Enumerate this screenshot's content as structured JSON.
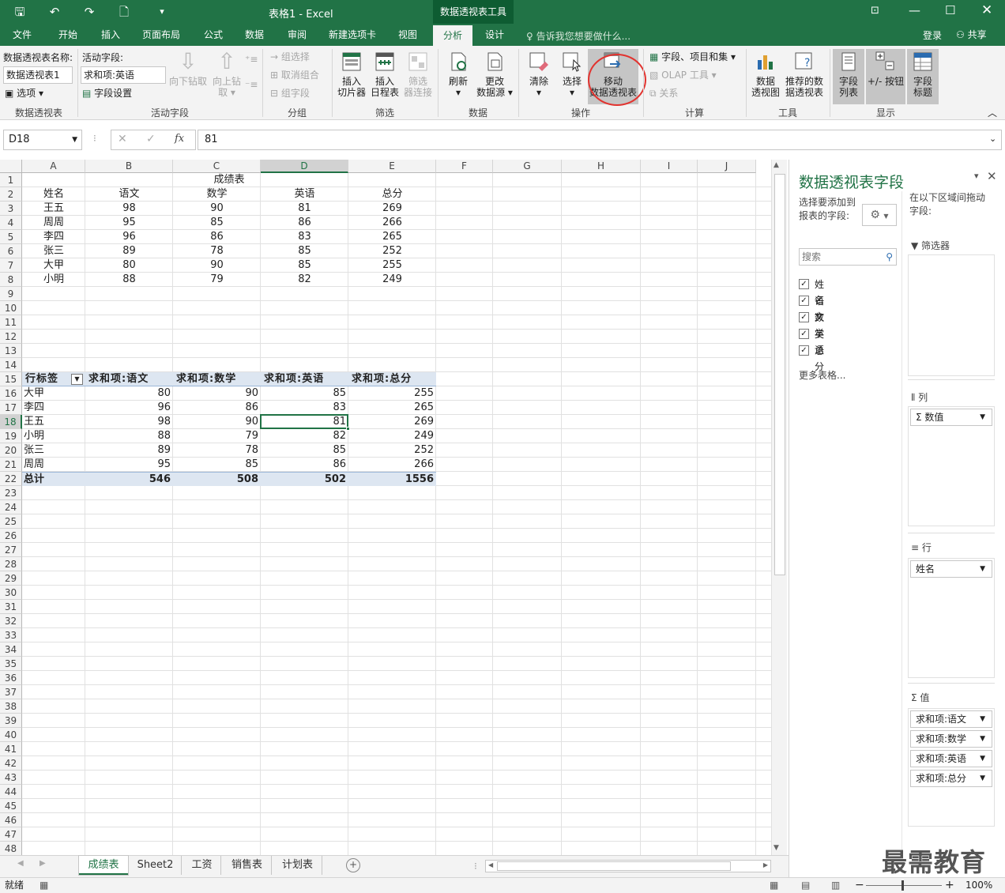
{
  "window": {
    "title": "表格1 - Excel",
    "context_tool": "数据透视表工具"
  },
  "tabs": [
    "文件",
    "开始",
    "插入",
    "页面布局",
    "公式",
    "数据",
    "审阅",
    "新建选项卡",
    "视图",
    "分析",
    "设计"
  ],
  "tellme": "告诉我您想要做什么...",
  "signin": "登录",
  "share": "共享",
  "ribbon": {
    "pt_name_label": "数据透视表名称:",
    "pt_name_value": "数据透视表1",
    "options": "选项",
    "grp_pivot": "数据透视表",
    "active_field_label": "活动字段:",
    "active_field_value": "求和项:英语",
    "field_settings": "字段设置",
    "drill_down": "向下钻取",
    "drill_up": "向上钻",
    "drill_up2": "取",
    "grp_active": "活动字段",
    "group_selection": "组选择",
    "ungroup": "取消组合",
    "group_field": "组字段",
    "grp_group": "分组",
    "insert_slicer": "插入",
    "insert_slicer2": "切片器",
    "insert_timeline": "插入",
    "insert_timeline2": "日程表",
    "filter_conn": "筛选",
    "filter_conn2": "器连接",
    "grp_filter": "筛选",
    "refresh": "刷新",
    "change_source": "更改",
    "change_source2": "数据源",
    "grp_data": "数据",
    "clear": "清除",
    "select": "选择",
    "move": "移动",
    "move2": "数据透视表",
    "grp_actions": "操作",
    "fields_items": "字段、项目和集",
    "olap": "OLAP 工具",
    "relations": "关系",
    "grp_calc": "计算",
    "pivotchart": "数据",
    "pivotchart2": "透视图",
    "recommended": "推荐的数",
    "recommended2": "据透视表",
    "grp_tools": "工具",
    "field_list": "字段",
    "field_list2": "列表",
    "buttons": "+/- 按钮",
    "headers": "字段",
    "headers2": "标题",
    "grp_show": "显示"
  },
  "formula": {
    "namebox": "D18",
    "value": "81"
  },
  "columns": [
    "A",
    "B",
    "C",
    "D",
    "E",
    "F",
    "G",
    "H",
    "I",
    "J"
  ],
  "source_table": {
    "title": "成绩表",
    "headers": [
      "姓名",
      "语文",
      "数学",
      "英语",
      "总分"
    ],
    "rows": [
      [
        "王五",
        "98",
        "90",
        "81",
        "269"
      ],
      [
        "周周",
        "95",
        "85",
        "86",
        "266"
      ],
      [
        "李四",
        "96",
        "86",
        "83",
        "265"
      ],
      [
        "张三",
        "89",
        "78",
        "85",
        "252"
      ],
      [
        "大甲",
        "80",
        "90",
        "85",
        "255"
      ],
      [
        "小明",
        "88",
        "79",
        "82",
        "249"
      ]
    ]
  },
  "pivot": {
    "headers": [
      "行标签",
      "求和项:语文",
      "求和项:数学",
      "求和项:英语",
      "求和项:总分"
    ],
    "rows": [
      [
        "大甲",
        "80",
        "90",
        "85",
        "255"
      ],
      [
        "李四",
        "96",
        "86",
        "83",
        "265"
      ],
      [
        "王五",
        "98",
        "90",
        "81",
        "269"
      ],
      [
        "小明",
        "88",
        "79",
        "82",
        "249"
      ],
      [
        "张三",
        "89",
        "78",
        "85",
        "252"
      ],
      [
        "周周",
        "95",
        "85",
        "86",
        "266"
      ]
    ],
    "total": [
      "总计",
      "546",
      "508",
      "502",
      "1556"
    ]
  },
  "panel": {
    "title": "数据透视表字段",
    "choose": "选择要添加到报表的字",
    "choose2": "段:",
    "drag": "在以下区域间拖动",
    "drag2": "字段:",
    "search": "搜索",
    "fields": [
      "姓名",
      "语文",
      "数学",
      "英语",
      "总分"
    ],
    "more": "更多表格...",
    "filters": "筛选器",
    "cols": "列",
    "col_item": "数值",
    "rows": "行",
    "row_item": "姓名",
    "values": "值",
    "value_items": [
      "求和项:语文",
      "求和项:数学",
      "求和项:英语",
      "求和项:总分"
    ]
  },
  "sheets": [
    "成绩表",
    "Sheet2",
    "工资",
    "销售表",
    "计划表"
  ],
  "status": {
    "ready": "就绪",
    "zoom": "100%"
  },
  "watermark": "最需教育"
}
